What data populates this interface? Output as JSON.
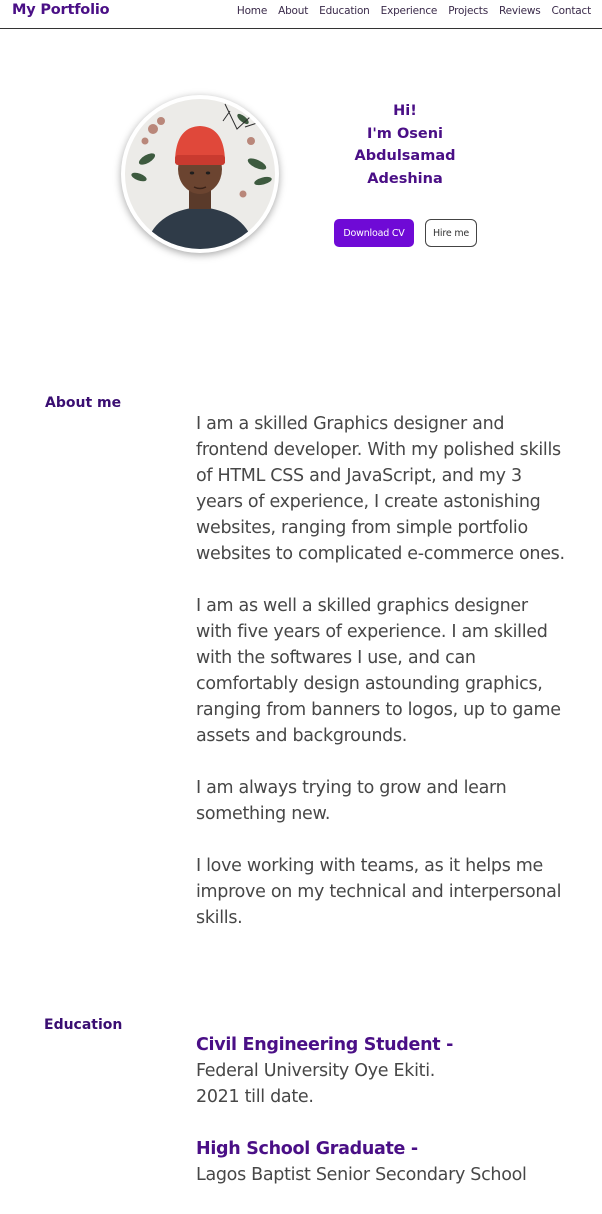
{
  "navbar": {
    "brand": "My Portfolio",
    "links": [
      "Home",
      "About",
      "Education",
      "Experience",
      "Projects",
      "Reviews",
      "Contact"
    ]
  },
  "hero": {
    "greeting_lines": [
      "Hi!",
      "I'm Oseni",
      "Abdulsamad",
      "Adeshina"
    ],
    "download_label": "Download CV",
    "hire_label": "Hire me",
    "accent_color": "#6f0ad6",
    "heading_color": "#4a0f86"
  },
  "about": {
    "label": "About me",
    "paragraphs": [
      "I am a skilled Graphics designer and frontend developer. With my polished skills of HTML CSS and JavaScript, and my 3 years of experience, I create astonishing websites, ranging from simple portfolio websites to complicated e-commerce ones.",
      "I am as well a skilled graphics designer with five years of experience. I am skilled with the softwares I use, and can comfortably design astounding graphics, ranging from banners to logos, up to game assets and backgrounds.",
      "I am always trying to grow and learn something new.",
      "I love working with teams, as it helps me improve on my technical and interpersonal skills."
    ]
  },
  "education": {
    "label": "Education",
    "items": [
      {
        "title": "Civil Engineering Student -",
        "school": "Federal University Oye Ekiti.",
        "period": "2021 till date."
      },
      {
        "title": "High School Graduate -",
        "school": "Lagos Baptist Senior Secondary School"
      }
    ]
  }
}
